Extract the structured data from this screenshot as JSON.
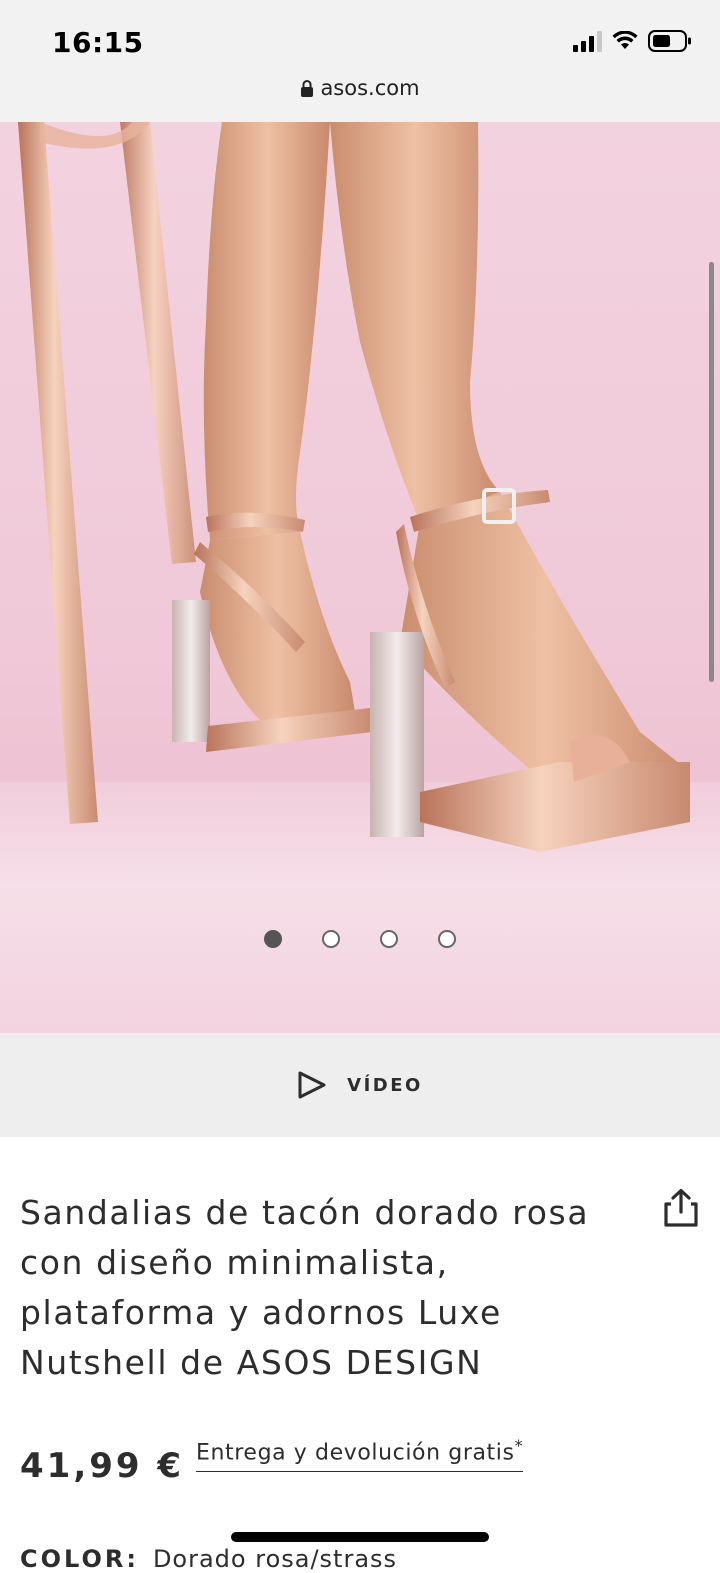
{
  "status_bar": {
    "time": "16:15",
    "icons": [
      "signal-icon",
      "wifi-icon",
      "battery-icon"
    ]
  },
  "browser": {
    "url": "asos.com",
    "lock_icon": "lock-icon"
  },
  "gallery": {
    "image_alt": "product-photo-rose-gold-platform-sandals",
    "dots_total": 4,
    "active_dot": 1
  },
  "video": {
    "label": "VÍDEO",
    "icon": "play-icon"
  },
  "product": {
    "title": "Sandalias de tacón dorado rosa con diseño minimalista, plataforma y adornos Luxe Nutshell de ASOS DESIGN",
    "share_icon": "share-icon",
    "price": "41,99 €",
    "delivery": "Entrega y devolución gratis",
    "delivery_mark": "*",
    "color_label": "COLOR:",
    "color_value": "Dorado rosa/strass"
  },
  "colors": {
    "background_pink": "#f0c9d8",
    "video_bar": "#eeeeee",
    "text": "#2d2d2d"
  }
}
